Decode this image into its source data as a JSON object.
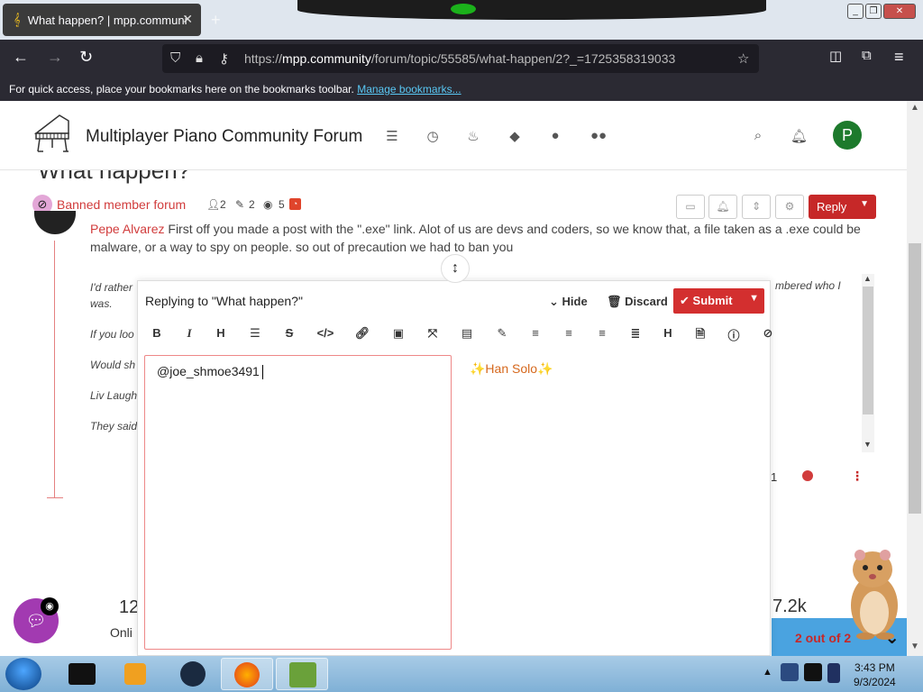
{
  "browser": {
    "tab_title": "What happen? | mpp.communi",
    "url_domain": "mpp.community",
    "url_prefix": "https://",
    "url_path": "/forum/topic/55585/what-happen/2?_=1725358319033",
    "bookmarks_text": "For quick access, place your bookmarks here on the bookmarks toolbar.",
    "bookmarks_link": "Manage bookmarks..."
  },
  "site": {
    "title": "Multiplayer Piano Community Forum",
    "avatar_letter": "P"
  },
  "topic": {
    "title": "What happen?",
    "category": "Banned member forum",
    "posters": "2",
    "posts": "2",
    "views": "5",
    "reply_label": "Reply"
  },
  "post": {
    "quoted_name": "Pepe Alvarez",
    "quote_text": " First off you made a post with the \".exe\" link. Alot of us are devs and coders, so we know that, a file taken as a .exe could be malware, or a way to spy on people. so out of precaution we had to ban you",
    "lines": [
      "I'd rather",
      "was.",
      "If you loo",
      "Would sh",
      "Liv Laugh",
      "They said"
    ],
    "right_text": "mbered who I",
    "reply_count": "1",
    "online_count": "12",
    "online_label": "Onli",
    "stat_count": "7.2k"
  },
  "pagination": {
    "label": "2 out of 2"
  },
  "composer": {
    "replying_to": "Replying to \"What happen?\"",
    "hide_label": "Hide",
    "discard_label": "Discard",
    "submit_label": "Submit",
    "editor_text": "@joe_shmoe3491",
    "preview_text": "✨Han Solo✨"
  },
  "taskbar": {
    "time": "3:43 PM",
    "date": "9/3/2024"
  },
  "colors": {
    "brand_red": "#c62828",
    "category_red": "#d13c3c",
    "chat_purple": "#a23ab1",
    "avatar_green": "#1d7a2c"
  }
}
